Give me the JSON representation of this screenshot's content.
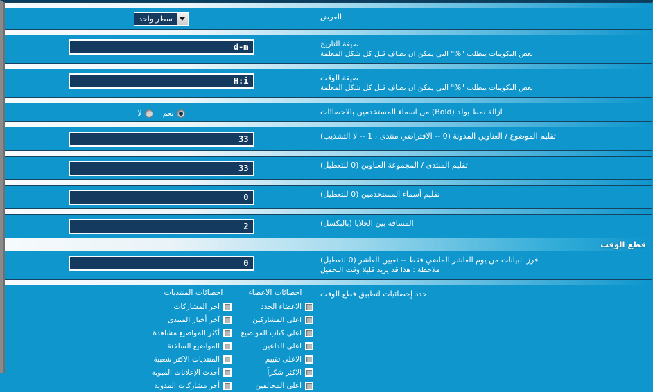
{
  "display": {
    "label": "العرض",
    "select_value": "سطر واحد",
    "options": [
      "سطر واحد"
    ]
  },
  "rows": [
    {
      "label": "صيغة التاريخ",
      "hint": "بعض التكوينات يتطلب \"%\" التي يمكن ان تضاف قبل كل شكل المعلمة",
      "value": "d-m"
    },
    {
      "label": "صيغة الوقت",
      "hint": "بعض التكوينات يتطلب \"%\" التي يمكن ان تضاف قبل كل شكل المعلمة",
      "value": "H:i"
    }
  ],
  "bold_row": {
    "label": "ازالة نمط بولد (Bold) من اسماء المستخدمين بالاحصائات",
    "yes_label": "نعم",
    "no_label": "لا",
    "selected": "نعم"
  },
  "numeric_rows": [
    {
      "label": "تقليم الموضوع / العناوين المدونة (0 -- الافتراضي منتدى ، 1 -- لا التشذيب)",
      "value": "33"
    },
    {
      "label": "تقليم المنتدى / المجموعة العناوين (0 للتعطيل)",
      "value": "33"
    },
    {
      "label": "تقليم أسماء المستخدمين (0 للتعطيل)",
      "value": "0"
    },
    {
      "label": "المسافة بين الخلايا (بالبكسل)",
      "value": "2"
    }
  ],
  "time_cut": {
    "title": "قطع الوقت",
    "label": "فرز البيانات من يوم العاشر الماضي فقط -- تعيين العاشر (0 لتعطيل)",
    "hint": "ملاحظة : هذا قد يزيد قليلا وقت التحميل",
    "value": "0"
  },
  "checkboxes": {
    "label": "حدد إحصائيات لتطبيق قطع الوقت",
    "columns": [
      {
        "head": "احصائات الاعضاء",
        "items": [
          {
            "text": "الاعضاء الجدد",
            "checked": false
          },
          {
            "text": "اعلى المشاركين",
            "checked": false
          },
          {
            "text": "اعلى كتاب المواضيع",
            "checked": false
          },
          {
            "text": "اعلى الداعين",
            "checked": false
          },
          {
            "text": "الاعلى تقييم",
            "checked": false
          },
          {
            "text": "الاكثر شكراً",
            "checked": false
          },
          {
            "text": "اعلى المخالفين",
            "checked": false
          }
        ]
      },
      {
        "head": "احصائات المنتديات",
        "items": [
          {
            "text": "اخر المشاركات",
            "checked": false
          },
          {
            "text": "آخر أخبار المنتدى",
            "checked": false
          },
          {
            "text": "أكثر المواضيع مشاهدة",
            "checked": false
          },
          {
            "text": "المواضيع الساخنة",
            "checked": false
          },
          {
            "text": "المنتديات الاكثر شعبية",
            "checked": false
          },
          {
            "text": "أحدث الإعلانات المبوبة",
            "checked": false
          },
          {
            "text": "أخر مشاركات المدونة",
            "checked": false
          }
        ]
      }
    ]
  },
  "colors": {
    "page_bg": "#0e96cd",
    "input_bg": "#143a60",
    "text": "#ffffff",
    "rule": "#16435f"
  }
}
